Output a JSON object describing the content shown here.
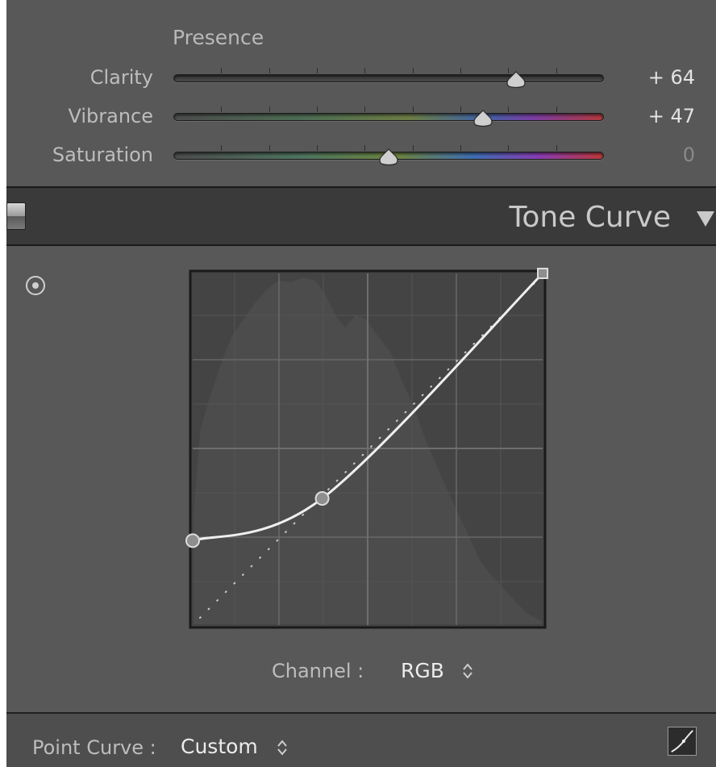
{
  "presence": {
    "title": "Presence",
    "sliders": [
      {
        "label": "Clarity",
        "value_text": "+ 64",
        "value": 64,
        "min": -100,
        "max": 100
      },
      {
        "label": "Vibrance",
        "value_text": "+ 47",
        "value": 47,
        "min": -100,
        "max": 100
      },
      {
        "label": "Saturation",
        "value_text": "0",
        "value": 0,
        "min": -100,
        "max": 100
      }
    ]
  },
  "tone_curve": {
    "title": "Tone Curve",
    "channel_label": "Channel :",
    "channel_value": "RGB",
    "point_curve_label": "Point Curve :",
    "point_curve_value": "Custom",
    "curve_points": [
      [
        0,
        0.24
      ],
      [
        0.37,
        0.36
      ],
      [
        1,
        1
      ]
    ]
  },
  "icons": {
    "target": "target-adjustment-icon",
    "collapse": "triangle-down-icon",
    "toggle": "panel-switch-icon",
    "point_curve": "point-curve-icon"
  },
  "colors": {
    "panel_bg": "#585858",
    "header_bg": "#3a3a3a"
  }
}
